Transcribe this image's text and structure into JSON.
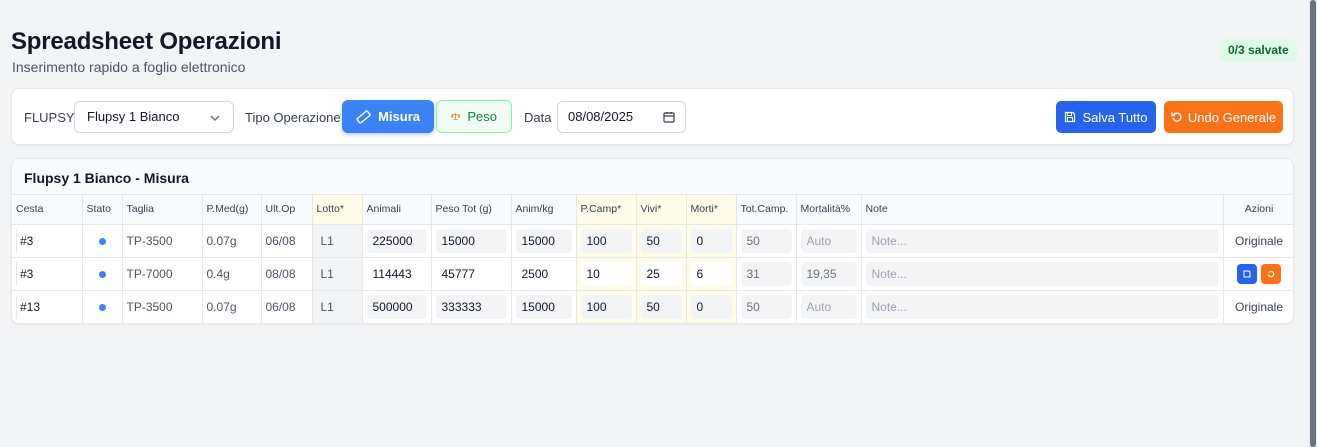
{
  "header": {
    "title": "Spreadsheet Operazioni",
    "subtitle": "Inserimento rapido a foglio elettronico",
    "saved_badge": "0/3 salvate"
  },
  "toolbar": {
    "flupsy_label": "FLUPSY",
    "flupsy_value": "Flupsy 1 Bianco",
    "tipo_label": "Tipo Operazione",
    "misura_label": "Misura",
    "peso_label": "Peso",
    "data_label": "Data",
    "data_value": "08/08/2025",
    "save_all_label": "Salva Tutto",
    "undo_all_label": "Undo Generale",
    "colors": {
      "primary": "#2563eb",
      "misura": "#3b82f6",
      "undo": "#f97316",
      "peso_bg": "#f0fdf4"
    }
  },
  "table": {
    "title": "Flupsy 1 Bianco - Misura",
    "columns": [
      "Cesta",
      "Stato",
      "Taglia",
      "P.Med(g)",
      "Ult.Op",
      "Lotto*",
      "Animali",
      "Peso Tot (g)",
      "Anim/kg",
      "P.Camp*",
      "Vivi*",
      "Morti*",
      "Tot.Camp.",
      "Mortalità%",
      "Note",
      "Azioni"
    ],
    "rows": [
      {
        "cesta": "#3",
        "taglia": "TP-3500",
        "pmed": "0.07g",
        "ultop": "06/08",
        "lotto": "L1",
        "animali": "225000",
        "pesotot": "15000",
        "animkg": "15000",
        "pcamp": "100",
        "vivi": "50",
        "morti": "0",
        "totcamp": "50",
        "mortalita": "Auto",
        "note": "Note...",
        "azioni": "Originale"
      },
      {
        "cesta": "#3",
        "taglia": "TP-7000",
        "pmed": "0.4g",
        "ultop": "08/08",
        "lotto": "L1",
        "animali": "114443",
        "pesotot": "45777",
        "animkg": "2500",
        "pcamp": "10",
        "vivi": "25",
        "morti": "6",
        "totcamp": "31",
        "mortalita": "19,35",
        "note": "Note...",
        "azioni": ""
      },
      {
        "cesta": "#13",
        "taglia": "TP-3500",
        "pmed": "0.07g",
        "ultop": "06/08",
        "lotto": "L1",
        "animali": "500000",
        "pesotot": "333333",
        "animkg": "15000",
        "pcamp": "100",
        "vivi": "50",
        "morti": "0",
        "totcamp": "50",
        "mortalita": "Auto",
        "note": "Note...",
        "azioni": "Originale"
      }
    ]
  }
}
